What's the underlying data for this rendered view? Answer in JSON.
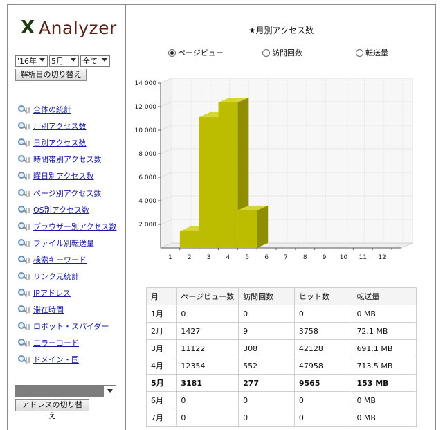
{
  "app": {
    "logo_mark": "X",
    "logo_name": "Analyzer"
  },
  "filters": {
    "year": "'16年",
    "month": "5月",
    "scope": "全て",
    "switch_date_button": "解析日の切り替え"
  },
  "sidebar": {
    "items": [
      {
        "label": "全体の統計",
        "icon": "magnifier-chart-icon"
      },
      {
        "label": "月別アクセス数",
        "icon": "magnifier-chart-icon"
      },
      {
        "label": "日別アクセス数",
        "icon": "magnifier-chart-icon"
      },
      {
        "label": "時間帯別アクセス数",
        "icon": "magnifier-chart-icon"
      },
      {
        "label": "曜日別アクセス数",
        "icon": "magnifier-chart-icon"
      },
      {
        "label": "ページ別アクセス数",
        "icon": "magnifier-chart-icon"
      },
      {
        "label": "OS別アクセス数",
        "icon": "magnifier-chart-icon"
      },
      {
        "label": "ブラウザー別アクセス数",
        "icon": "magnifier-chart-icon"
      },
      {
        "label": "ファイル別転送量",
        "icon": "magnifier-chart-icon"
      },
      {
        "label": "検索キーワード",
        "icon": "magnifier-chart-icon"
      },
      {
        "label": "リンク元統計",
        "icon": "magnifier-chart-icon"
      },
      {
        "label": "IPアドレス",
        "icon": "magnifier-chart-icon"
      },
      {
        "label": "滞在時間",
        "icon": "magnifier-chart-icon"
      },
      {
        "label": "ロボット・スパイダー",
        "icon": "magnifier-chart-icon"
      },
      {
        "label": "エラーコード",
        "icon": "magnifier-chart-icon"
      },
      {
        "label": "ドメイン・国",
        "icon": "magnifier-chart-icon"
      }
    ],
    "switch_address_button": "アドレスの切り替え"
  },
  "main": {
    "title": "★月別アクセス数",
    "radios": [
      {
        "label": "ページビュー",
        "selected": true
      },
      {
        "label": "訪問回数",
        "selected": false
      },
      {
        "label": "転送量",
        "selected": false
      }
    ]
  },
  "chart_data": {
    "type": "bar",
    "title": "★月別アクセス数",
    "categories": [
      "1",
      "2",
      "3",
      "4",
      "5",
      "6",
      "7",
      "8",
      "9",
      "10",
      "11",
      "12"
    ],
    "values": [
      0,
      1427,
      11122,
      12354,
      3181,
      0,
      0,
      0,
      0,
      0,
      0,
      0
    ],
    "yticks": [
      "2 000",
      "4 000",
      "6 000",
      "8 000",
      "10 000",
      "12 000",
      "14 000"
    ],
    "ylim": [
      0,
      14000
    ],
    "bar_color": "#bdbd00",
    "grid": true,
    "style": "3d"
  },
  "table": {
    "headers": [
      "月",
      "ページビュー数",
      "訪問回数",
      "ヒット数",
      "転送量"
    ],
    "rows": [
      [
        "1月",
        "0",
        "0",
        "0",
        "0 MB"
      ],
      [
        "2月",
        "1427",
        "9",
        "3758",
        "72.1 MB"
      ],
      [
        "3月",
        "11122",
        "308",
        "42128",
        "691.1 MB"
      ],
      [
        "4月",
        "12354",
        "552",
        "47958",
        "713.5 MB"
      ],
      [
        "5月",
        "3181",
        "277",
        "9565",
        "153 MB"
      ],
      [
        "6月",
        "0",
        "0",
        "0",
        "0 MB"
      ],
      [
        "7月",
        "0",
        "0",
        "0",
        "0 MB"
      ]
    ],
    "current_row": 4
  }
}
